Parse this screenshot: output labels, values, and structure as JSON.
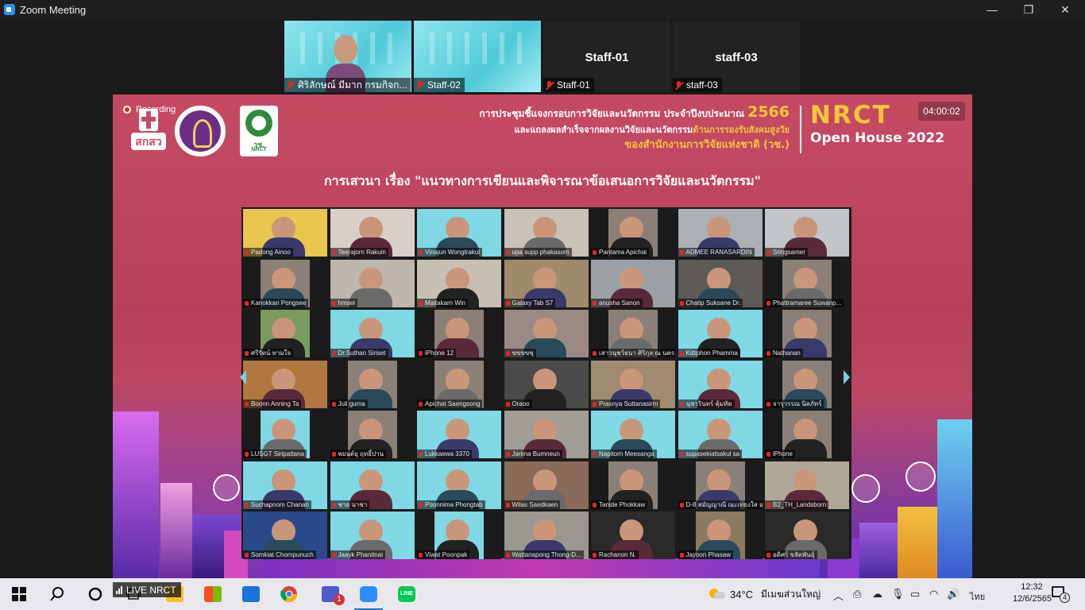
{
  "window": {
    "title": "Zoom Meeting",
    "minimize_icon": "minimize-icon",
    "restore_icon": "restore-icon",
    "close_icon": "close-icon"
  },
  "thumbnails": [
    {
      "name": "ศิริลักษณ์ มีมาก กรมกิจก...",
      "video": true,
      "muted": true
    },
    {
      "name": "Staff-02",
      "video": true,
      "muted": true
    },
    {
      "name": "Staff-01",
      "label": "Staff-01",
      "video": false,
      "muted": true
    },
    {
      "name": "staff-03",
      "label": "staff-03",
      "video": false,
      "muted": true
    }
  ],
  "share": {
    "recording": "Recording",
    "timer": "04:00:02",
    "logo1_text": "สกสว",
    "logo3_t1": "วช.",
    "logo3_t2": "NRCT",
    "headline_line1": "การประชุมชี้แจงกรอบการวิจัยและนวัตกรรม ประจำปีงบประมาณ",
    "headline_year": "2566",
    "headline_line2_a": "และแถลงผลสำเร็จจากผลงานวิจัยและนวัตกรรม",
    "headline_line2_b": "ด้านการรองรับสังคมสูงวัย",
    "headline_line3": "ของสำนักงานการวิจัยแห่งชาติ (วช.)",
    "brand_line1": "NRCT",
    "brand_line2": "Open House 2022",
    "topic": "การเสวนา เรื่อง \"แนวทางการเขียนและพิจารณาข้อเสนอการวิจัยและนวัตกรรม\"",
    "live_label": "LIVE NRCT"
  },
  "participants": [
    "Padong Ainoo",
    "Teerajorn Rakuin",
    "Vinajun Wongtrakul",
    "upa supp phakasom",
    "Pantama Apichai",
    "ADMEE RANASARDIN",
    "Sringsamer",
    "Kanokkan Pongsee",
    "hmsel",
    "Maitakarn Win",
    "Galaxy Tab S7",
    "anusha Sanon",
    "Chatip Suksane Dr.",
    "Phattramaree Suwanp...",
    "ศรีรัตน์ ทามใจ",
    "Dr.Suthan Siriset",
    "iPhone 12",
    "ขขขขขุ",
    "เสาวนุชว์ธนา ศิริกุล ณ นคร",
    "Kittiphon Phamma",
    "Nathanan",
    "Boonn Anning Ta",
    "Juli guma",
    "Apichat Saengsong",
    "Oraoo",
    "Prasnya Suttanasirm",
    "นุชารินทร์ คุ้มทัด",
    "จารุวรรณ นิลภัทร์",
    "LUSGT Siripattana",
    "พยนต์ยุ ฤทธิ์ปาน",
    "Lukkaewa 3370",
    "Jarima Bumneun",
    "Napitorn Meesanga",
    "supasekiatsakul sa",
    "iPhone",
    "Suchapnom Chanan",
    "ชาย นาชา",
    "Poonnima Phongtab",
    "Wilas Saedkaen",
    "Tanide Phokkaw",
    "D-8 สมัญญาณี ณะเท่ยงใส อ.",
    "B2_TH_Landsborn",
    "Somkiat Chompunuch",
    "Jaayk Phanitnai",
    "Viwat Poonpak",
    "Wattanapong Thong-D...",
    "Rachanon N.",
    "Jayoon Phasaw",
    "อดิศร์ ขจัดพันธุ์"
  ],
  "taskbar": {
    "items": [
      "start-icon",
      "search-icon",
      "cortana-icon",
      "task-view-icon",
      "file-explorer-icon",
      "store-icon",
      "mail-icon",
      "chrome-icon",
      "teams-icon",
      "zoom-icon",
      "line-icon"
    ],
    "teams_badge": "1",
    "line_label": "LINE",
    "temperature": "34°C",
    "weather": "มีเมฆส่วนใหญ่",
    "language": "ไทย",
    "time": "12:32",
    "date": "12/6/2565",
    "notifications": "4"
  }
}
